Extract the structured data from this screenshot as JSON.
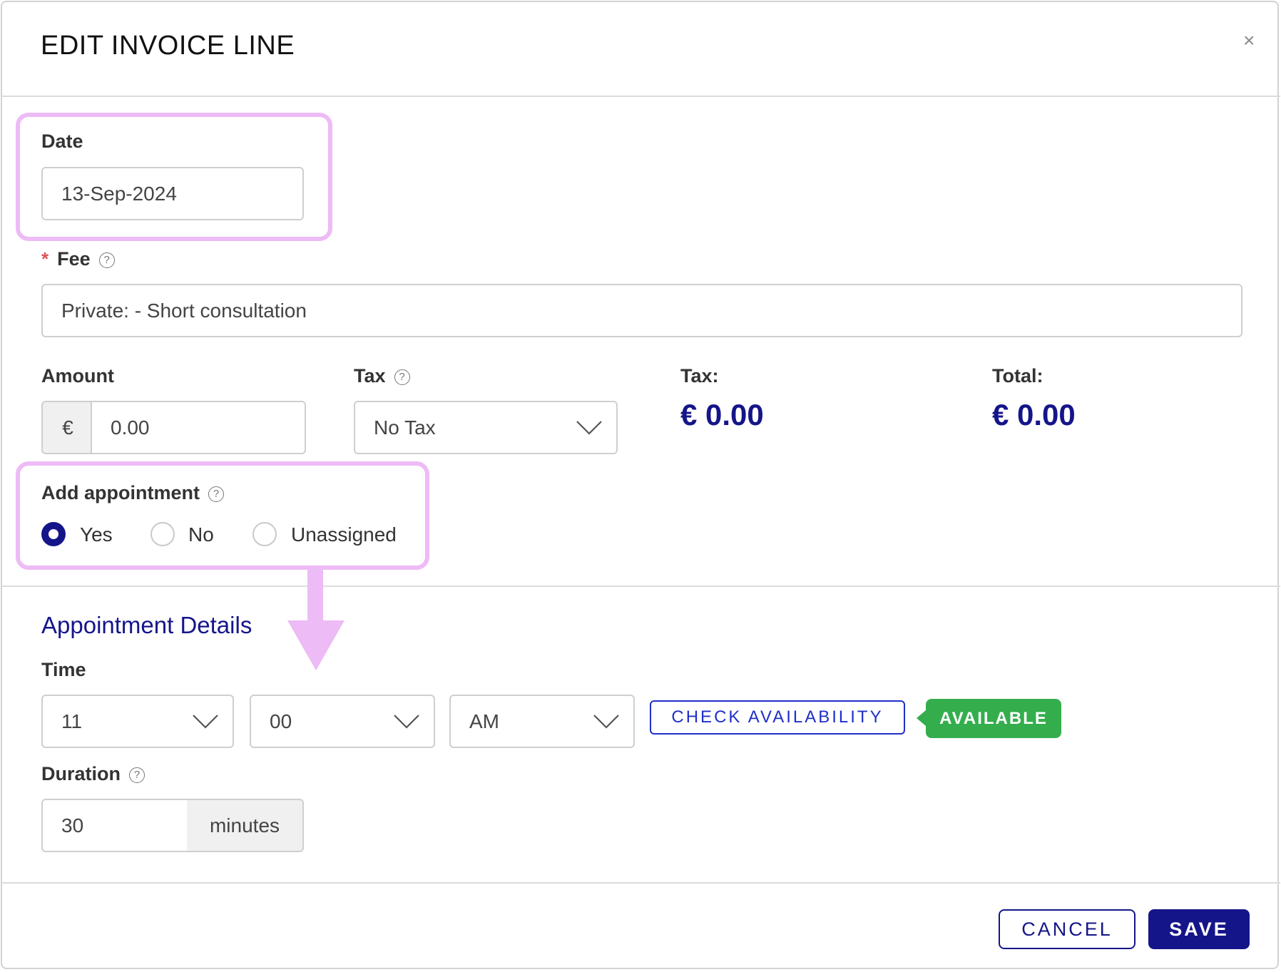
{
  "dialog": {
    "title": "EDIT INVOICE LINE",
    "close_icon": "×"
  },
  "date": {
    "label": "Date",
    "value": "13-Sep-2024"
  },
  "fee": {
    "required_mark": "*",
    "label": "Fee",
    "value": "Private:  - Short consultation"
  },
  "amount": {
    "label": "Amount",
    "currency_symbol": "€",
    "value": "0.00"
  },
  "tax_select": {
    "label": "Tax",
    "selected": "No Tax"
  },
  "tax_total": {
    "label": "Tax:",
    "value": "€ 0.00"
  },
  "total": {
    "label": "Total:",
    "value": "€ 0.00"
  },
  "add_appointment": {
    "label": "Add appointment",
    "options": [
      "Yes",
      "No",
      "Unassigned"
    ],
    "selected": "Yes"
  },
  "appointment_details": {
    "title": "Appointment Details",
    "time_label": "Time",
    "hour": "11",
    "minute": "00",
    "period": "AM",
    "check_button": "CHECK AVAILABILITY",
    "availability_badge": "AVAILABLE",
    "duration_label": "Duration",
    "duration_value": "30",
    "duration_unit": "minutes"
  },
  "footer": {
    "cancel_label": "CANCEL",
    "save_label": "SAVE"
  },
  "colors": {
    "primary": "#15158a",
    "link_blue": "#1f2fc7",
    "available_green": "#34ae4d",
    "highlight_pink": "#edbbf5",
    "required_red": "#e05353"
  },
  "icons": {
    "help": "question-circle-icon",
    "dropdown": "chevron-down-icon",
    "close": "close-icon"
  }
}
